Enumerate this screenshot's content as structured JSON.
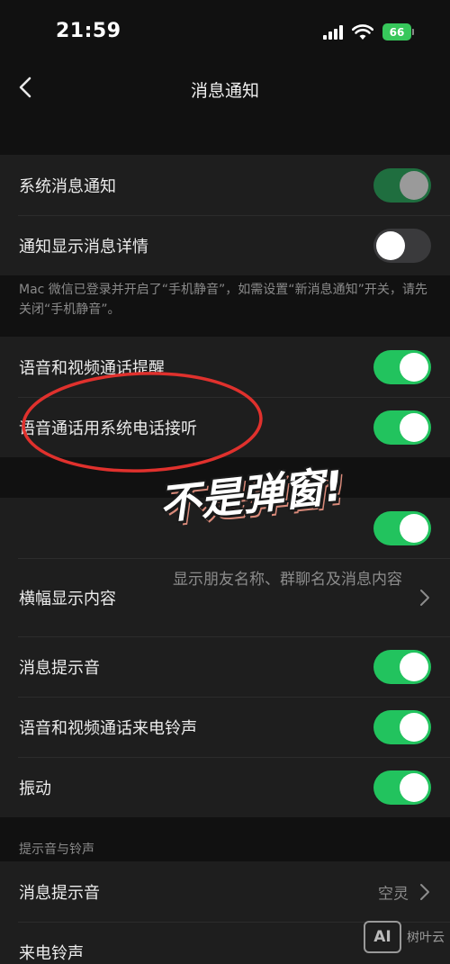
{
  "status_bar": {
    "time": "21:59",
    "battery": "66"
  },
  "nav": {
    "title": "消息通知"
  },
  "group1": [
    {
      "label": "系统消息通知",
      "toggle": "dim"
    },
    {
      "label": "通知显示消息详情",
      "toggle": "off"
    }
  ],
  "note1": "Mac 微信已登录并开启了“手机静音”，如需设置“新消息通知”开关，请先关闭“手机静音”。",
  "group2": [
    {
      "label": "语音和视频通话提醒",
      "toggle": "on"
    },
    {
      "label": "语音通话用系统电话接听",
      "toggle": "on"
    }
  ],
  "group3": {
    "row0_toggle": "on",
    "banner_label": "横幅显示内容",
    "banner_value": "显示朋友名称、群聊名及消息内容",
    "rows": [
      {
        "label": "消息提示音",
        "toggle": "on"
      },
      {
        "label": "语音和视频通话来电铃声",
        "toggle": "on"
      },
      {
        "label": "振动",
        "toggle": "on"
      }
    ]
  },
  "section_header": "提示音与铃声",
  "group4": [
    {
      "label": "消息提示音",
      "value": "空灵"
    },
    {
      "label": "来电铃声",
      "value": ""
    }
  ],
  "annotation": {
    "sticker_text": "不是弹窗!",
    "circle_color": "#e0312d"
  },
  "watermark": {
    "logo": "AI",
    "text": "树叶云"
  },
  "colors": {
    "toggle_on": "#22c35e",
    "background": "#111111",
    "cell": "#1e1e1e"
  }
}
